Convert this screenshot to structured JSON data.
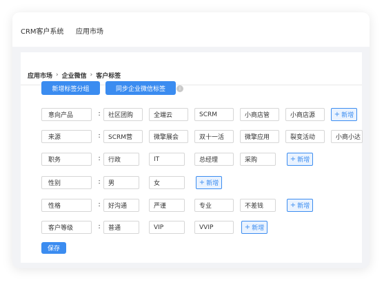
{
  "nav": {
    "app_name": "CRM客户系统",
    "app_market": "应用市场"
  },
  "breadcrumb": {
    "items": [
      "应用市场",
      "企业微信",
      "客户标签"
    ],
    "separator": "›"
  },
  "toolbar": {
    "new_group": "新增标签分组",
    "sync": "同步企业微信标签",
    "info_icon": "i"
  },
  "rows": [
    {
      "label": "意向产品",
      "tags": [
        "社区团购",
        "全端云",
        "SCRM",
        "小商店管",
        "小商店源"
      ],
      "add": true
    },
    {
      "label": "来源",
      "tags": [
        "SCRM营",
        "微擎展会",
        "双十一活",
        "微擎应用",
        "裂变活动",
        "小商小达"
      ],
      "add": false
    },
    {
      "label": "职务",
      "tags": [
        "行政",
        "IT",
        "总经理",
        "采购"
      ],
      "add": true
    },
    {
      "label": "性别",
      "tags": [
        "男",
        "女"
      ],
      "add": true
    },
    {
      "label": "性格",
      "tags": [
        "好沟通",
        "严谨",
        "专业",
        "不差钱"
      ],
      "add": true
    },
    {
      "label": "客户等级",
      "tags": [
        "普通",
        "VIP",
        "VVIP"
      ],
      "add": true
    }
  ],
  "add_label": "新增",
  "colon": ":",
  "save_label": "保存",
  "colors": {
    "primary": "#3b8cf0",
    "add_bg": "#eaf3ff",
    "page_bg": "#f2f3f6"
  }
}
